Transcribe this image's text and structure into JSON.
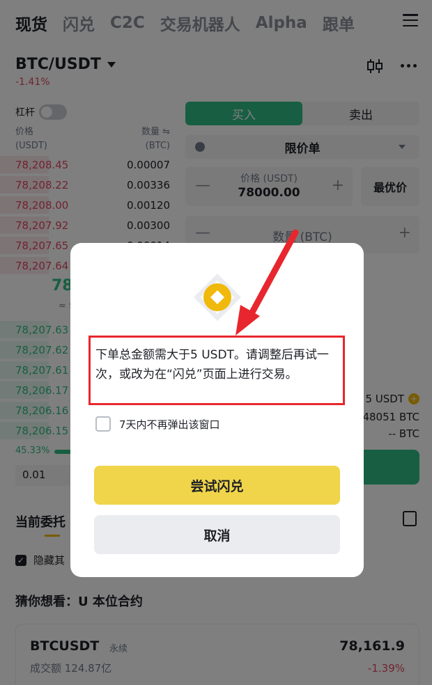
{
  "topnav": {
    "tabs": [
      "现货",
      "闪兑",
      "C2C",
      "交易机器人",
      "Alpha",
      "跟单"
    ],
    "active_index": 0
  },
  "pair": {
    "name": "BTC/USDT",
    "change": "-1.41%"
  },
  "leverage_label": "杠杆",
  "orderbook": {
    "price_label": "价格",
    "price_unit": "(USDT)",
    "qty_label": "数量 ⇋",
    "qty_unit": "(BTC)",
    "asks": [
      {
        "price": "78,208.45",
        "qty": "0.00007"
      },
      {
        "price": "78,208.22",
        "qty": "0.00336"
      },
      {
        "price": "78,208.00",
        "qty": "0.00120"
      },
      {
        "price": "78,207.92",
        "qty": "0.00300"
      },
      {
        "price": "78,207.65",
        "qty": "0.00014"
      },
      {
        "price": "78,207.64",
        "qty": ""
      }
    ],
    "mid_price": "78",
    "mid_sub": "≈ $",
    "bids": [
      {
        "price": "78,207.63"
      },
      {
        "price": "78,207.62"
      },
      {
        "price": "78,207.61"
      },
      {
        "price": "78,206.17"
      },
      {
        "price": "78,206.16"
      },
      {
        "price": "78,206.15"
      }
    ],
    "ratio": "45.33%",
    "precision": "0.01"
  },
  "trade_panel": {
    "buy_label": "买入",
    "sell_label": "卖出",
    "order_type": "限价单",
    "price_label": "价格 (USDT)",
    "price_value": "78000.00",
    "best_price_label": "最优价",
    "qty_label": "数量 (BTC)",
    "available_1": "5 USDT",
    "available_2": "48051 BTC",
    "available_3": "-- BTC"
  },
  "orders": {
    "tab_label": "当前委托",
    "hide_label": "隐藏其"
  },
  "suggest": {
    "title": "猜你想看：U 本位合约",
    "symbol": "BTCUSDT",
    "tag": "永续",
    "volume": "成交额 124.87亿",
    "price": "78,161.9",
    "change": "-1.39%"
  },
  "modal": {
    "message": "下单总金额需大于5 USDT。请调整后再试一次，或改为在“闪兑”页面上进行交易。",
    "checkbox_label": "7天内不再弹出该窗口",
    "primary_label": "尝试闪兑",
    "cancel_label": "取消"
  },
  "colors": {
    "accent": "#f0d54a",
    "buy_green": "#2ebd85",
    "sell_red": "#e2465f",
    "annotation_red": "#e8262d"
  }
}
